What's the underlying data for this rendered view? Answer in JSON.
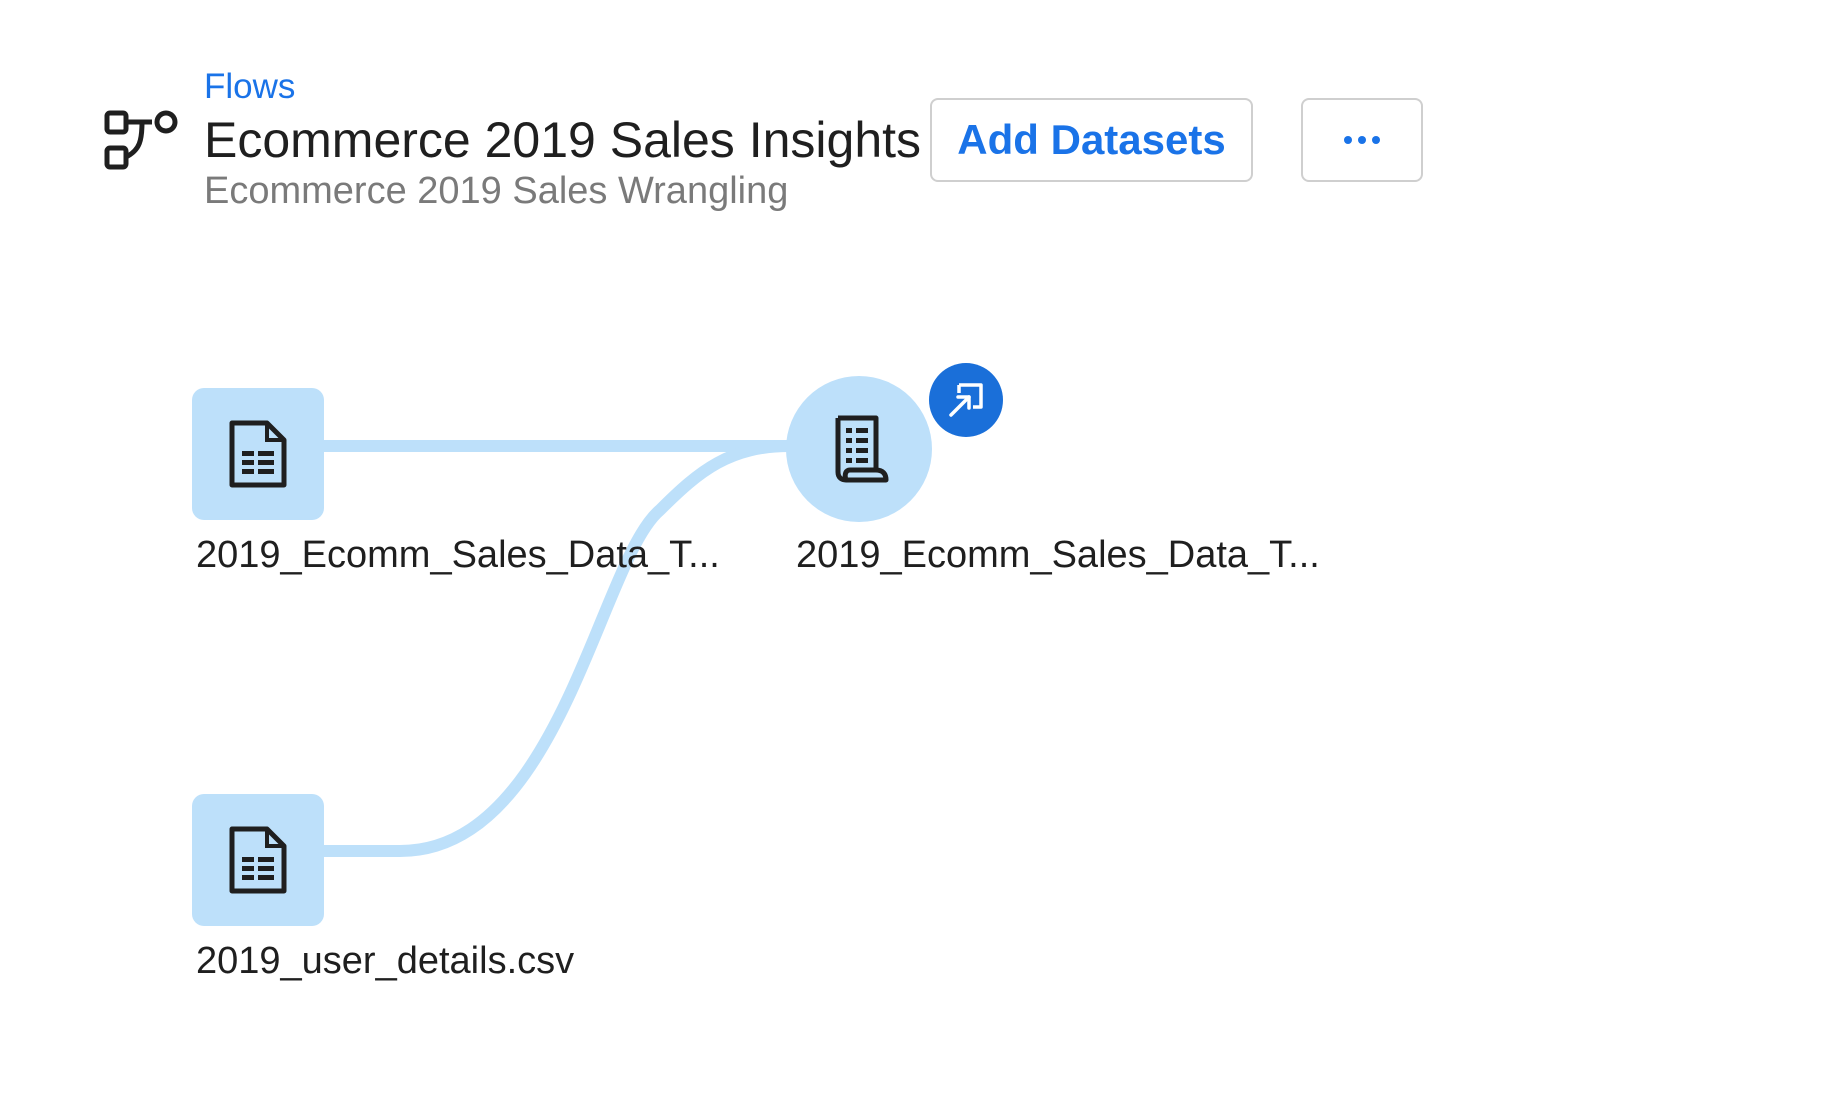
{
  "header": {
    "breadcrumb": "Flows",
    "title": "Ecommerce 2019 Sales Insights",
    "subtitle": "Ecommerce 2019 Sales Wrangling",
    "flow_icon": "flow-icon"
  },
  "toolbar": {
    "add_datasets_label": "Add Datasets",
    "more_icon": "more-horizontal-icon"
  },
  "colors": {
    "accent": "#1a73e8",
    "node_fill": "#bde0fa",
    "connector": "#bde0fa",
    "badge": "#1a6fd9"
  },
  "flow": {
    "nodes": [
      {
        "label": "2019_Ecomm_Sales_Data_T...",
        "kind": "imported-dataset",
        "icon": "dataset-file-icon"
      },
      {
        "label": "2019_user_details.csv",
        "kind": "imported-dataset",
        "icon": "dataset-file-icon"
      },
      {
        "label": "2019_Ecomm_Sales_Data_T...",
        "kind": "recipe",
        "icon": "recipe-icon",
        "badge_icon": "reference-arrow-icon"
      }
    ]
  }
}
